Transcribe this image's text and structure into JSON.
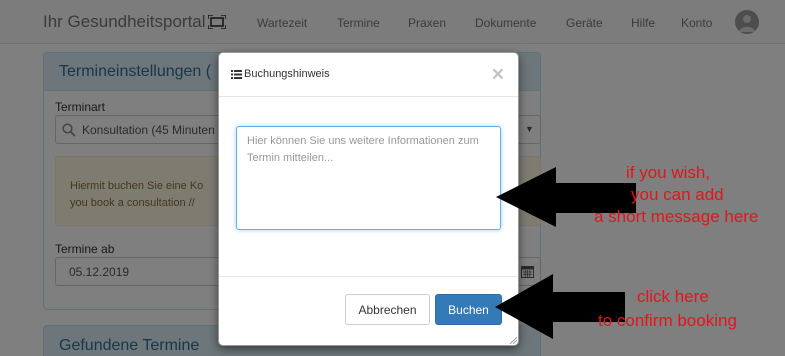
{
  "navbar": {
    "brand": "Ihr Gesundheitsportal",
    "items": [
      "Wartezeit",
      "Termine",
      "Praxen",
      "Dokumente",
      "Geräte",
      "Hilfe",
      "Konto"
    ]
  },
  "settings_panel": {
    "title": "Termineinstellungen (",
    "type_label": "Terminart",
    "type_value": "Konsultation (45 Minuten",
    "alert_line1": "Hiermit buchen Sie eine Ko",
    "alert_line2": "you book a consultation // ",
    "date_label": "Termine ab",
    "date_value": "05.12.2019"
  },
  "results_panel": {
    "title": "Gefundene Termine"
  },
  "modal": {
    "title": "Buchungshinweis",
    "close": "×",
    "textarea_placeholder": "Hier können Sie uns weitere Informationen zum Termin mitteilen...",
    "cancel_label": "Abbrechen",
    "book_label": "Buchen",
    "primary_color": "#337ab7"
  },
  "annotations": {
    "note1_line1": "if you wish,",
    "note1_line2": "you can add",
    "note1_line3": "a short message here",
    "note2_line1": "click here",
    "note2_line2": "to confirm booking",
    "color": "#e5141b"
  },
  "icons": [
    "fullscreen-icon",
    "user-avatar-icon",
    "search-icon",
    "caret-down-icon",
    "calendar-icon",
    "list-icon",
    "close-icon",
    "resize-grip-icon",
    "arrow-icon"
  ]
}
